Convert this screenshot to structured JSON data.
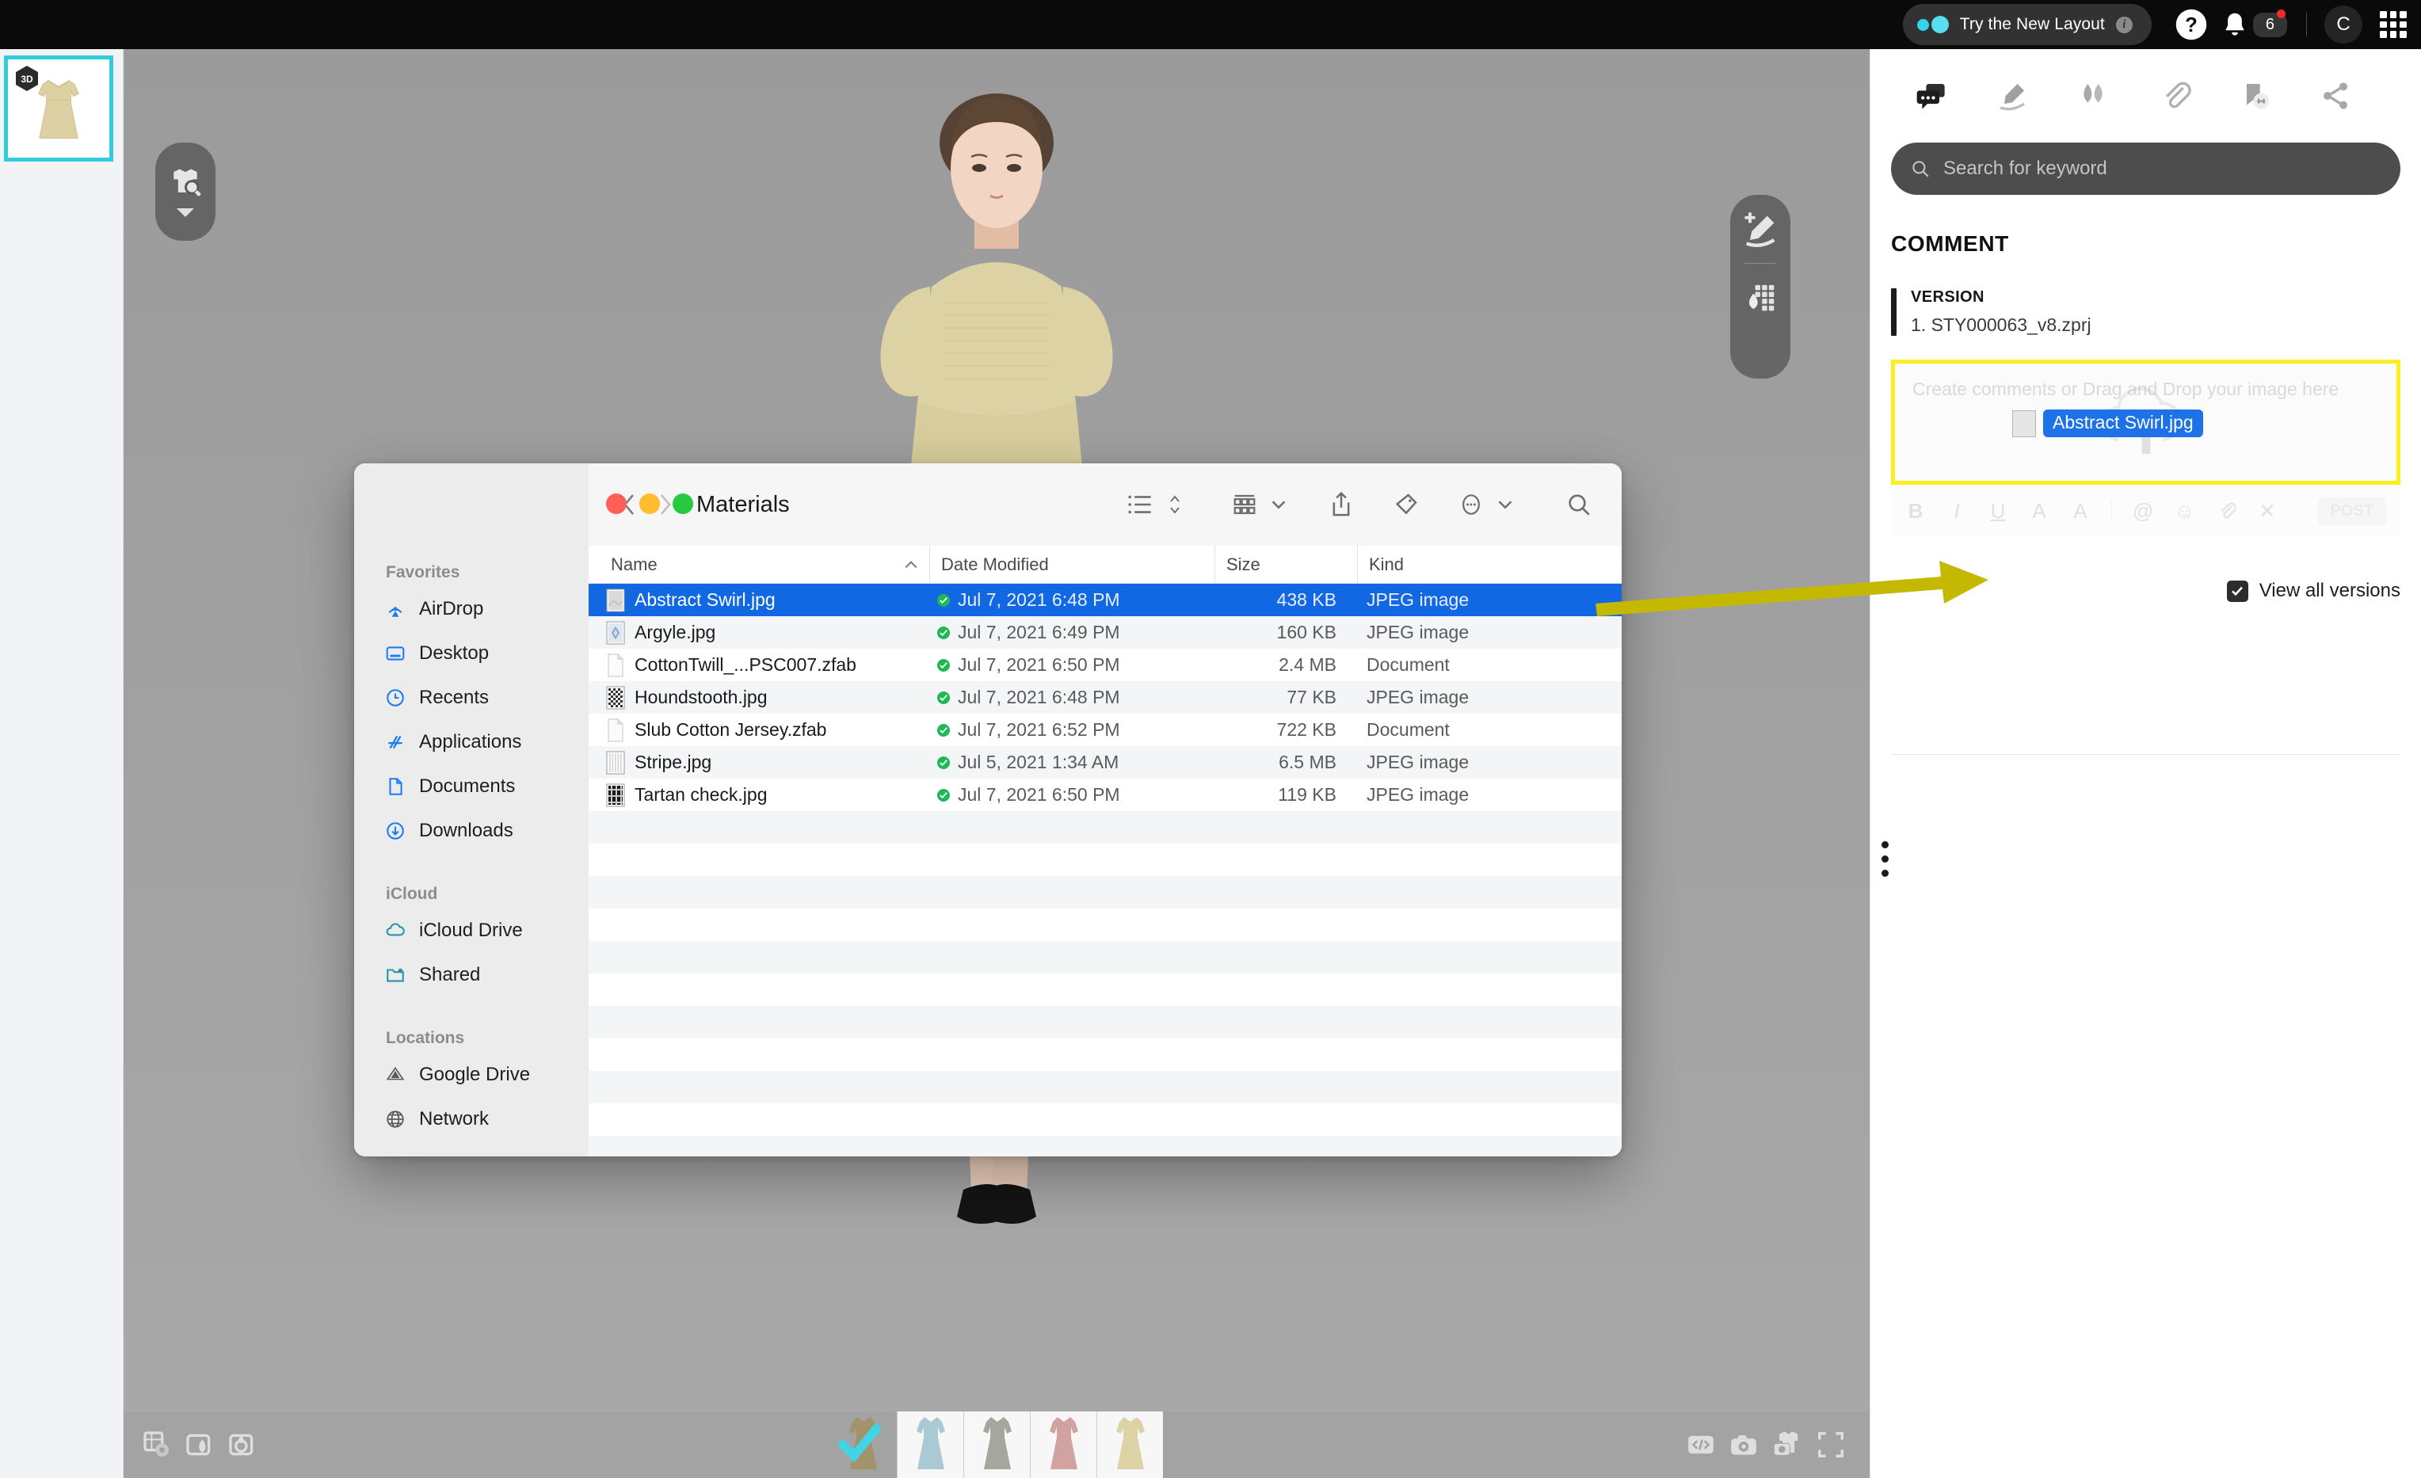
{
  "topbar": {
    "new_layout_label": "Try the New Layout",
    "info_icon": "info-icon",
    "help_icon": "help-icon",
    "bell_icon": "bell-icon",
    "notification_count": "6",
    "avatar_initial": "C",
    "apps_grid_icon": "apps-grid-icon"
  },
  "left_strip": {
    "thumbnail_badge": "3D"
  },
  "viewport": {
    "tool_left": {
      "garment_search_icon": "garment-search-icon",
      "chevron_down_icon": "chevron-down-icon"
    },
    "tool_right": {
      "add_marker_icon": "add-marker-pen-icon",
      "fabric_drop_icon": "fabric-drop-icon"
    },
    "bottom_left_tools": [
      "grid-settings-icon",
      "fabric-preview-icon",
      "render-drop-icon"
    ],
    "bottom_right_tools": [
      "code-icon",
      "camera-icon",
      "garment-snapshot-icon",
      "fullscreen-icon"
    ],
    "colorways": [
      {
        "name": "colorway-olive",
        "color": "#a39369",
        "selected": true
      },
      {
        "name": "colorway-blue",
        "color": "#a9c9d4",
        "selected": false
      },
      {
        "name": "colorway-gray",
        "color": "#a3a79e",
        "selected": false
      },
      {
        "name": "colorway-pink",
        "color": "#d0a3a1",
        "selected": false
      },
      {
        "name": "colorway-cream",
        "color": "#ddd2a5",
        "selected": false
      }
    ]
  },
  "right_panel": {
    "tabs": [
      {
        "name": "tab-comment",
        "icon": "comment-bubbles-icon",
        "active": true
      },
      {
        "name": "tab-markup",
        "icon": "highlighter-pen-icon",
        "active": false
      },
      {
        "name": "tab-fabric",
        "icon": "fabric-drops-icon",
        "active": false
      },
      {
        "name": "tab-attachment",
        "icon": "paperclip-icon",
        "active": false
      },
      {
        "name": "tab-bookmark-link",
        "icon": "bookmark-link-icon",
        "active": false
      },
      {
        "name": "tab-share",
        "icon": "share-icon",
        "active": false
      }
    ],
    "search": {
      "placeholder": "Search for keyword",
      "value": "",
      "icon": "search-icon"
    },
    "section_title": "COMMENT",
    "version": {
      "label": "VERSION",
      "file": "1. STY000063_v8.zprj"
    },
    "comment_box": {
      "placeholder": "Create comments or Drag and Drop your image here",
      "upload_icon": "upload-cloud-icon",
      "dragged_file": "Abstract Swirl.jpg",
      "highlight_color": "#fcee21"
    },
    "format_bar": {
      "items": [
        "B",
        "I",
        "U",
        "A",
        "A"
      ],
      "icon_items": [
        "mention-icon",
        "emoji-icon",
        "attach-icon",
        "close-icon"
      ],
      "post_label": "POST"
    },
    "view_all_versions": {
      "label": "View all versions",
      "checked": true
    },
    "resize_handle": "panel-resize-handle"
  },
  "finder": {
    "title": "Materials",
    "traffic_lights": [
      "close-button",
      "minimize-button",
      "zoom-button"
    ],
    "nav": {
      "back_icon": "chevron-left-icon",
      "forward_icon": "chevron-right-icon"
    },
    "toolbar_icons": [
      "list-view-icon",
      "sort-chevrons-icon",
      "group-by-icon",
      "group-by-chevron-icon",
      "share-icon",
      "tag-icon",
      "more-actions-icon",
      "more-actions-chevron-icon",
      "search-icon"
    ],
    "sidebar": [
      {
        "group": "Favorites",
        "items": [
          {
            "label": "AirDrop",
            "icon": "airdrop-icon"
          },
          {
            "label": "Desktop",
            "icon": "desktop-icon"
          },
          {
            "label": "Recents",
            "icon": "recents-clock-icon"
          },
          {
            "label": "Applications",
            "icon": "applications-icon"
          },
          {
            "label": "Documents",
            "icon": "documents-icon"
          },
          {
            "label": "Downloads",
            "icon": "downloads-icon"
          }
        ]
      },
      {
        "group": "iCloud",
        "items": [
          {
            "label": "iCloud Drive",
            "icon": "icloud-drive-icon"
          },
          {
            "label": "Shared",
            "icon": "shared-folder-icon"
          }
        ]
      },
      {
        "group": "Locations",
        "items": [
          {
            "label": "Google Drive",
            "icon": "google-drive-icon"
          },
          {
            "label": "Network",
            "icon": "network-globe-icon"
          }
        ]
      }
    ],
    "columns": [
      "Name",
      "Date Modified",
      "Size",
      "Kind"
    ],
    "sort_indicator": "chevron-up-icon",
    "files": [
      {
        "name": "Abstract Swirl.jpg",
        "date": "Jul 7, 2021 6:48 PM",
        "size": "438 KB",
        "kind": "JPEG image",
        "icon": "image-file-icon",
        "selected": true,
        "synced": true
      },
      {
        "name": "Argyle.jpg",
        "date": "Jul 7, 2021 6:49 PM",
        "size": "160 KB",
        "kind": "JPEG image",
        "icon": "image-file-icon",
        "selected": false,
        "synced": true
      },
      {
        "name": "CottonTwill_...PSC007.zfab",
        "date": "Jul 7, 2021 6:50 PM",
        "size": "2.4 MB",
        "kind": "Document",
        "icon": "document-file-icon",
        "selected": false,
        "synced": true
      },
      {
        "name": "Houndstooth.jpg",
        "date": "Jul 7, 2021 6:48 PM",
        "size": "77 KB",
        "kind": "JPEG image",
        "icon": "image-file-icon",
        "selected": false,
        "synced": true
      },
      {
        "name": "Slub Cotton Jersey.zfab",
        "date": "Jul 7, 2021 6:52 PM",
        "size": "722 KB",
        "kind": "Document",
        "icon": "document-file-icon",
        "selected": false,
        "synced": true
      },
      {
        "name": "Stripe.jpg",
        "date": "Jul 5, 2021 1:34 AM",
        "size": "6.5 MB",
        "kind": "JPEG image",
        "icon": "image-file-icon",
        "selected": false,
        "synced": true
      },
      {
        "name": "Tartan check.jpg",
        "date": "Jul 7, 2021 6:50 PM",
        "size": "119 KB",
        "kind": "JPEG image",
        "icon": "image-file-icon",
        "selected": false,
        "synced": true
      }
    ]
  },
  "annotation": {
    "arrow_color": "#c5b800",
    "highlight_color": "#fcee21"
  }
}
